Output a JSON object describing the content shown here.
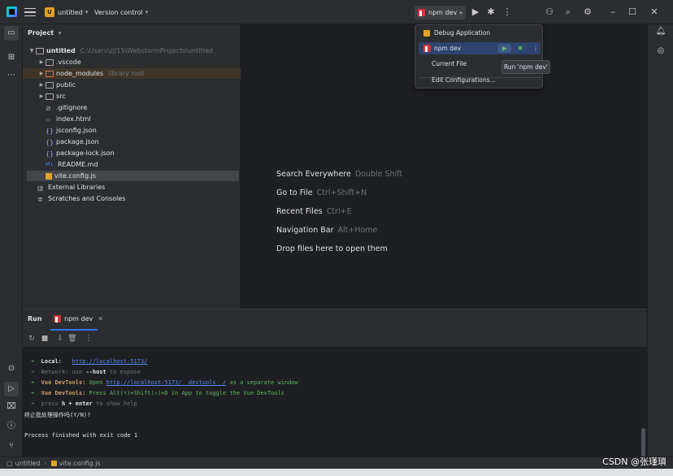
{
  "titlebar": {
    "project_badge": "U",
    "project_name": "untitled",
    "vcs": "Version control",
    "run_config": "npm dev"
  },
  "project_panel": {
    "title": "Project",
    "root": {
      "name": "untitled",
      "path": "C:\\Users\\zjl15\\WebstormProjects\\untitled"
    },
    "items": [
      {
        "name": ".vscode",
        "kind": "folder"
      },
      {
        "name": "node_modules",
        "kind": "folder",
        "note": "library root"
      },
      {
        "name": "public",
        "kind": "folder"
      },
      {
        "name": "src",
        "kind": "folder"
      },
      {
        "name": ".gitignore",
        "kind": "file"
      },
      {
        "name": "index.html",
        "kind": "file"
      },
      {
        "name": "jsconfig.json",
        "kind": "file"
      },
      {
        "name": "package.json",
        "kind": "file"
      },
      {
        "name": "package-lock.json",
        "kind": "file"
      },
      {
        "name": "README.md",
        "kind": "file",
        "badge": "M↓"
      },
      {
        "name": "vite.config.js",
        "kind": "file"
      }
    ],
    "external_libraries": "External Libraries",
    "scratches": "Scratches and Consoles"
  },
  "editor_hints": [
    {
      "label": "Search Everywhere",
      "key": "Double Shift"
    },
    {
      "label": "Go to File",
      "key": "Ctrl+Shift+N"
    },
    {
      "label": "Recent Files",
      "key": "Ctrl+E"
    },
    {
      "label": "Navigation Bar",
      "key": "Alt+Home"
    },
    {
      "label": "Drop files here to open them",
      "key": ""
    }
  ],
  "run_popup": {
    "items": [
      "Debug Application",
      "npm dev",
      "Current File",
      "Edit Configurations..."
    ],
    "tooltip": "Run 'npm dev'"
  },
  "run_panel": {
    "title": "Run",
    "tab": "npm dev",
    "console": {
      "local_label": "Local:",
      "local_url": "http://localhost:5173/",
      "network_prefix": "Network: use ",
      "network_flag": "--host",
      "network_suffix": " to expose",
      "devtools1_label": "Vue DevTools:",
      "devtools1_pre": " Open ",
      "devtools1_url": "http://localhost:5173/__devtools__/",
      "devtools1_post": " as a separate window",
      "devtools2_label": "Vue DevTools:",
      "devtools2_text": " Press Alt(⌥)+Shift(⇧)+D in App to toggle the Vue DevTools",
      "help_pre": "press ",
      "help_key": "h + enter",
      "help_post": " to show help",
      "prompt": "终止批处理操作吗(Y/N)?",
      "exit": "Process finished with exit code 1"
    }
  },
  "statusbar": {
    "project": "untitled",
    "file": "vite.config.js"
  },
  "watermark": "CSDN @张瑾瑣"
}
